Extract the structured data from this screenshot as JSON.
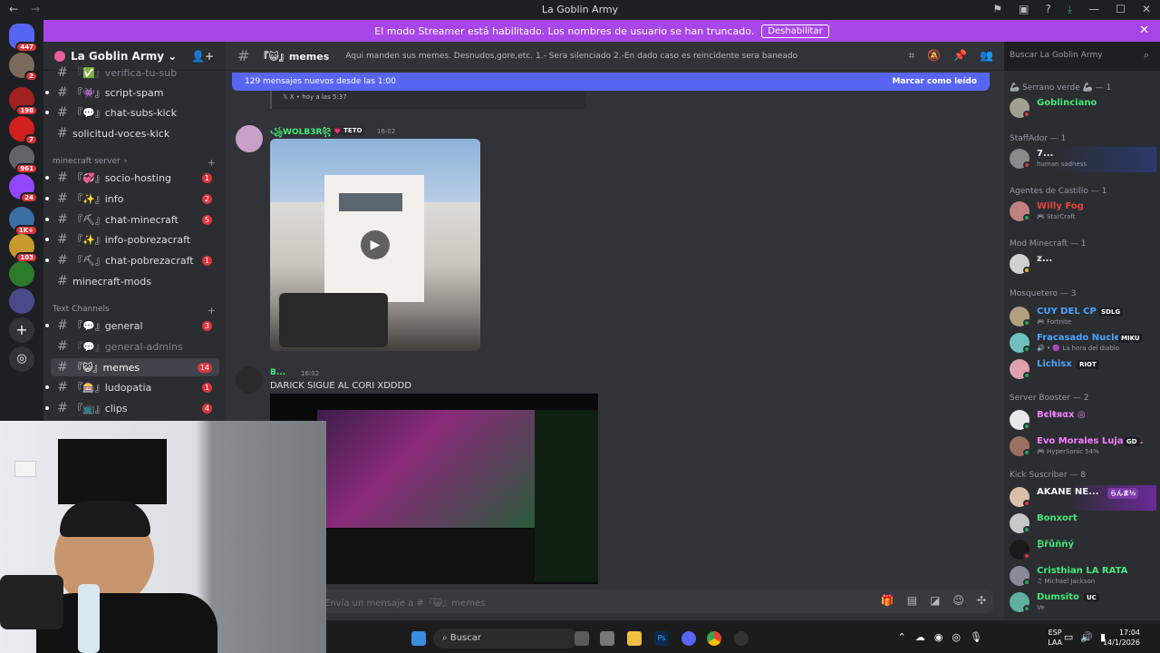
{
  "window": {
    "title": "La Goblin Army",
    "back": "←",
    "forward": "→",
    "icons": [
      "⚑",
      "▣",
      "?",
      "⤓",
      "—",
      "☐",
      "✕"
    ]
  },
  "banner": {
    "text": "El modo Streamer está habilitado. Los nombres de usuario se han truncado.",
    "button": "Deshabilitar",
    "close": "✕"
  },
  "servers": {
    "badges": [
      "447",
      "2",
      "198",
      "7",
      "961",
      "24",
      "1K+",
      "103"
    ]
  },
  "guild": {
    "name": "La Goblin Army",
    "chevron": "⌄",
    "invite_icon": "👤+"
  },
  "channels": [
    {
      "label": "『✅』verifica-tu-sub",
      "muted": true
    },
    {
      "label": "『👾』script-spam"
    },
    {
      "label": "『💬』chat-subs-kick"
    },
    {
      "label": "solicitud-voces-kick"
    },
    {
      "label": "『💞』socio-hosting",
      "count": "1"
    },
    {
      "label": "『✨』info",
      "count": "2"
    },
    {
      "label": "『⛏』chat-minecraft",
      "count": "5"
    },
    {
      "label": "『✨』info-pobrezacraft"
    },
    {
      "label": "『⛏』chat-pobrezacraft",
      "count": "1"
    },
    {
      "label": "minecraft-mods"
    },
    {
      "label": "『💬』general",
      "count": "3"
    },
    {
      "label": "『💬』general-admins",
      "muted": true
    },
    {
      "label": "『😺』memes",
      "count": "14",
      "active": true
    },
    {
      "label": "『🎰』ludopatia",
      "count": "1"
    },
    {
      "label": "『📺』clips",
      "count": "4"
    }
  ],
  "categories": {
    "minecraft": "minecraft server",
    "text": "Text Channels"
  },
  "header": {
    "channel": "『😺』memes",
    "topic": "Aqui manden sus memes. Desnudos,gore,etc. 1.- Sera silenciado 2.-En dado caso es reincidente sera baneado",
    "search_placeholder": "Buscar La Goblin Army"
  },
  "chat": {
    "new_messages": "129 mensajes nuevos desde las 1:00",
    "mark_read": "Marcar como leído",
    "prev_embed": "𝕏   X • hoy a las 5:37",
    "messages": [
      {
        "author": "꧁WOLB3R꧂",
        "tag": "💗 TETO",
        "time": "16:02"
      },
      {
        "author": "B...",
        "time": "16:02",
        "text": "DARICK SIGUE AL CORI XDDDD"
      }
    ],
    "composer_placeholder": "Envía un mensaje a #『😺』memes"
  },
  "members": {
    "roles": [
      {
        "name": "🦾 Serrano verde 🦾 — 1"
      },
      {
        "name": "StaffAdor — 1"
      },
      {
        "name": "Agentes de Castillo — 1"
      },
      {
        "name": "Mod Minecraft — 1"
      },
      {
        "name": "Mosquetero — 3"
      },
      {
        "name": "Server Booster — 2"
      },
      {
        "name": "Kick Suscriber — 8"
      }
    ],
    "list": [
      {
        "name": "Goblinciano",
        "color": "#43e97b"
      },
      {
        "name": "7...",
        "color": "#f2f3f5",
        "activity": "human sadness"
      },
      {
        "name": "Willy Fog",
        "color": "#e8453c",
        "activity": "🎮 StarCraft"
      },
      {
        "name": "z...",
        "color": "#f2f3f5"
      },
      {
        "name": "CUY DEL CP",
        "color": "#4fa3ff",
        "activity": "🎮 Fortnite",
        "tag": "SDLG"
      },
      {
        "name": "Fracasado Nuclear",
        "color": "#4fa3ff",
        "activity": "🔊 • 🟣 La hora del diablo",
        "tag": "MIKU"
      },
      {
        "name": "Lichisx",
        "color": "#4fa3ff",
        "tag": "RIOT"
      },
      {
        "name": "Bєlŧяαx ◎",
        "color": "#f47fff"
      },
      {
        "name": "Evo Morales Lujan ...",
        "color": "#f47fff",
        "activity": "🎮 HyperSonic 54%",
        "tag": "GD"
      },
      {
        "name": "AKANE NE...",
        "color": "#f2f3f5",
        "tag": "らんま½"
      },
      {
        "name": "Bonxort",
        "color": "#43e97b"
      },
      {
        "name": "₿řůññý",
        "color": "#43e97b"
      },
      {
        "name": "Cristhian LA RATA",
        "color": "#43e97b",
        "activity": "♫ Michael Jackson"
      },
      {
        "name": "Dumsito",
        "color": "#43e97b",
        "activity": "Ve",
        "tag": "UC"
      }
    ]
  },
  "taskbar": {
    "search": "Buscar",
    "lang_top": "ESP",
    "lang_bottom": "LAA",
    "time": "17:04",
    "date": "14/1/2026"
  },
  "colors": {
    "accent": "#5865f2",
    "banner": "#a845e8",
    "badge": "#da373c"
  }
}
